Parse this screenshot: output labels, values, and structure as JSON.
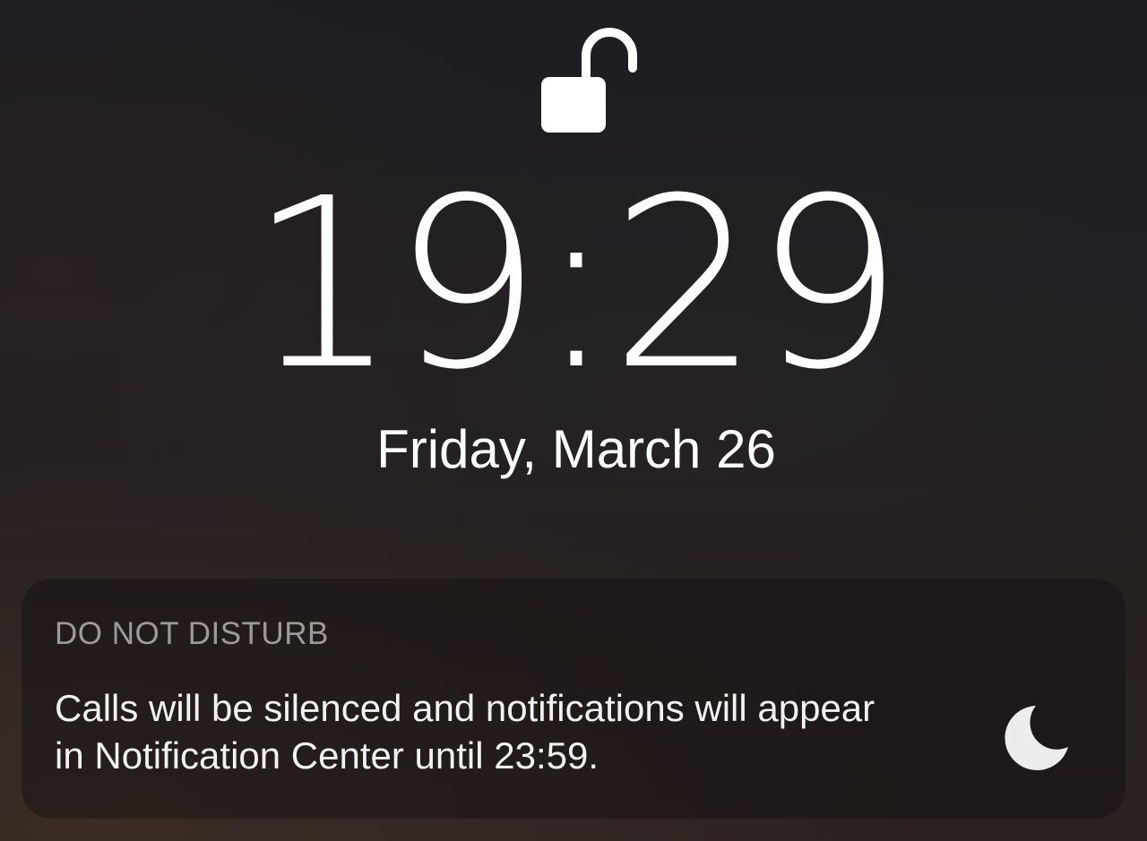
{
  "lock_screen": {
    "lock_icon": "unlocked-padlock-icon",
    "time": "19:29",
    "date": "Friday, March 26"
  },
  "do_not_disturb": {
    "title": "DO NOT DISTURB",
    "message": "Calls will be silenced and notifications will appear in Notification Center until 23:59.",
    "icon": "moon-icon"
  },
  "colors": {
    "background": "#1c1b1f",
    "text_primary": "#ffffff",
    "text_secondary": "#9d9a9c",
    "card_background": "rgba(16,14,16,0.42)"
  }
}
